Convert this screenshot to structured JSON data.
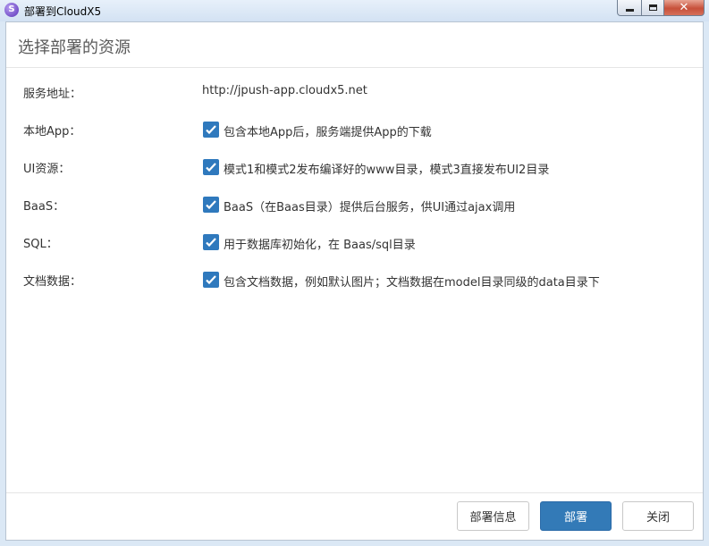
{
  "window": {
    "title": "部署到CloudX5",
    "icon": "app-logo-icon",
    "close_glyph": "✕"
  },
  "dialog": {
    "title": "选择部署的资源",
    "service": {
      "label": "服务地址：",
      "value": "http://jpush-app.cloudx5.net"
    },
    "options": [
      {
        "label": "本地App：",
        "checked": true,
        "desc": "包含本地App后，服务端提供App的下载"
      },
      {
        "label": "UI资源：",
        "checked": true,
        "desc": "模式1和模式2发布编译好的www目录，模式3直接发布UI2目录"
      },
      {
        "label": "BaaS：",
        "checked": true,
        "desc": "BaaS（在Baas目录）提供后台服务，供UI通过ajax调用"
      },
      {
        "label": "SQL：",
        "checked": true,
        "desc": "用于数据库初始化，在 Baas/sql目录"
      },
      {
        "label": "文档数据：",
        "checked": true,
        "desc": "包含文档数据，例如默认图片；文档数据在model目录同级的data目录下"
      }
    ],
    "buttons": {
      "info": "部署信息",
      "deploy": "部署",
      "close": "关闭"
    }
  },
  "colors": {
    "primary": "#337ab7",
    "checkbox": "#2f79bd"
  }
}
